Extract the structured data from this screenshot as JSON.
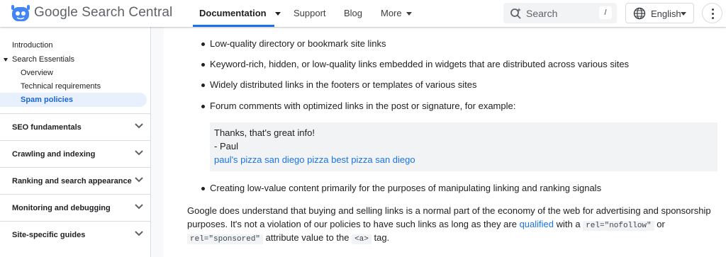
{
  "header": {
    "brand": "Google Search Central",
    "nav": [
      {
        "label": "Documentation"
      },
      {
        "label": "Support"
      },
      {
        "label": "Blog"
      },
      {
        "label": "More"
      }
    ],
    "search_placeholder": "Search",
    "search_shortcut": "/",
    "language": "English"
  },
  "sidebar": {
    "top_items": [
      "Introduction",
      "Search Essentials",
      "Overview",
      "Technical requirements",
      "Spam policies"
    ],
    "sections": [
      "SEO fundamentals",
      "Crawling and indexing",
      "Ranking and search appearance",
      "Monitoring and debugging",
      "Site-specific guides"
    ]
  },
  "content": {
    "bullets": [
      "Low-quality directory or bookmark site links",
      "Keyword-rich, hidden, or low-quality links embedded in widgets that are distributed across various sites",
      "Widely distributed links in the footers or templates of various sites",
      "Forum comments with optimized links in the post or signature, for example:"
    ],
    "quote": {
      "line1": "Thanks, that's great info!",
      "line2": "- Paul",
      "line3": "paul's pizza san diego pizza best pizza san diego"
    },
    "bullet_last": "Creating low-value content primarily for the purposes of manipulating linking and ranking signals",
    "paragraph": {
      "line1": "Google does understand that buying and selling links is a normal part of the economy of the web for advertising and sponsorship",
      "line2_pre": "purposes. It's not a violation of our policies to have such links as long as they are ",
      "line2_link": "qualified",
      "line2_mid": " with a ",
      "code_nofollow": "rel=\"nofollow\"",
      "line2_end": " or",
      "code_sponsored": "rel=\"sponsored\"",
      "line3_mid": " attribute value to the ",
      "code_a": "<a>",
      "line3_end": " tag."
    }
  },
  "colors": {
    "accent": "#1a73e8",
    "selected_bg": "#e8f0fe",
    "quote_bg": "#f1f3f4"
  }
}
